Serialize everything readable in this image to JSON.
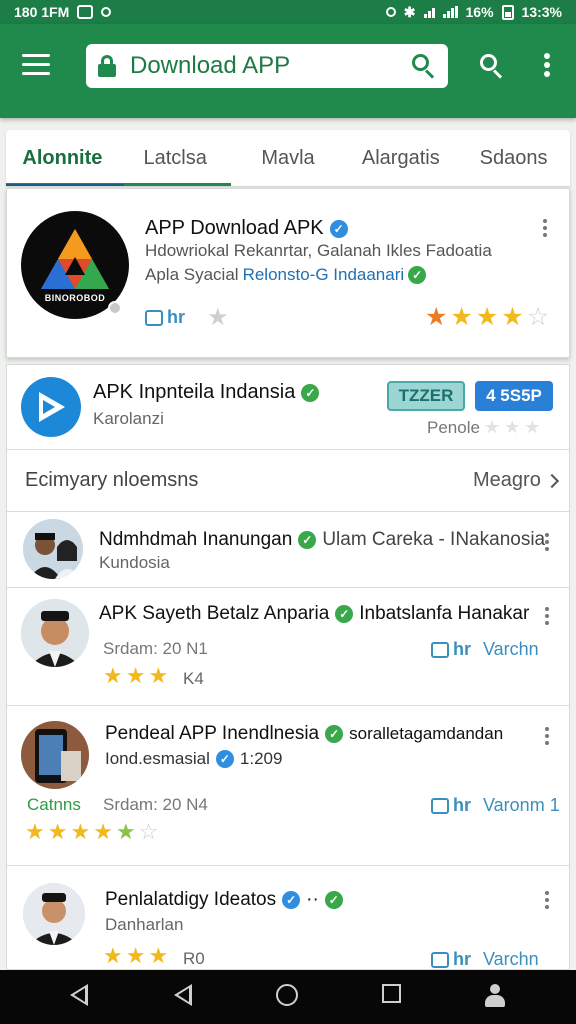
{
  "status_bar": {
    "time": "180 1FM",
    "battery": "16%",
    "clock": "13:3%"
  },
  "app_bar": {
    "search_text": "Download APP"
  },
  "tabs": [
    {
      "label": "Alonnite",
      "active": true
    },
    {
      "label": "Latclsa",
      "active": false
    },
    {
      "label": "Mavla",
      "active": false
    },
    {
      "label": "Alargatis",
      "active": false
    },
    {
      "label": "Sdaons",
      "active": false
    }
  ],
  "featured": {
    "logo_text": "BINOROBOD",
    "title": "APP Download APK",
    "desc_line1": "Hdowriokal Rekanrtar, Galanah Ikles Fadoatia",
    "desc_prefix": "Apla Syacial",
    "desc_link": "Relonsto-G Indaanari",
    "like_label": "hr",
    "rating": 4
  },
  "promo": {
    "title": "APK Inpnteila Indansia",
    "subtitle": "Karolanzi",
    "install_label": "TZZER",
    "price_label": "4 5S5P",
    "pending_label": "Penole"
  },
  "section": {
    "title": "Ecimyary nloemsns",
    "more_label": "Meagro"
  },
  "list": [
    {
      "title": "Ndmhdmah Inanungan",
      "extra": "Ulam Careka - INakanosia",
      "subtitle": "Kundosia"
    },
    {
      "title": "APK Sayeth Betalz Anparia",
      "extra": "Inbatslanfa Hanakar",
      "meta": "Srdam: 20 N1",
      "count": "K4",
      "like_label": "hr",
      "share_label": "Varchn",
      "rating": 3
    },
    {
      "title": "Pendeal APP Inendlnesia",
      "extra": "soralletagamdandan",
      "subtitle": "Iond.esmasial",
      "sub_number": "1:209",
      "category": "Catnns",
      "meta": "Srdam: 20 N4",
      "like_label": "hr",
      "share_label": "Varonm 1",
      "rating": 4.5
    },
    {
      "title": "Penlalatdigy Ideatos",
      "subtitle": "Danharlan",
      "count": "R0",
      "like_label": "hr",
      "share_label": "Varchn",
      "rating": 3
    }
  ]
}
